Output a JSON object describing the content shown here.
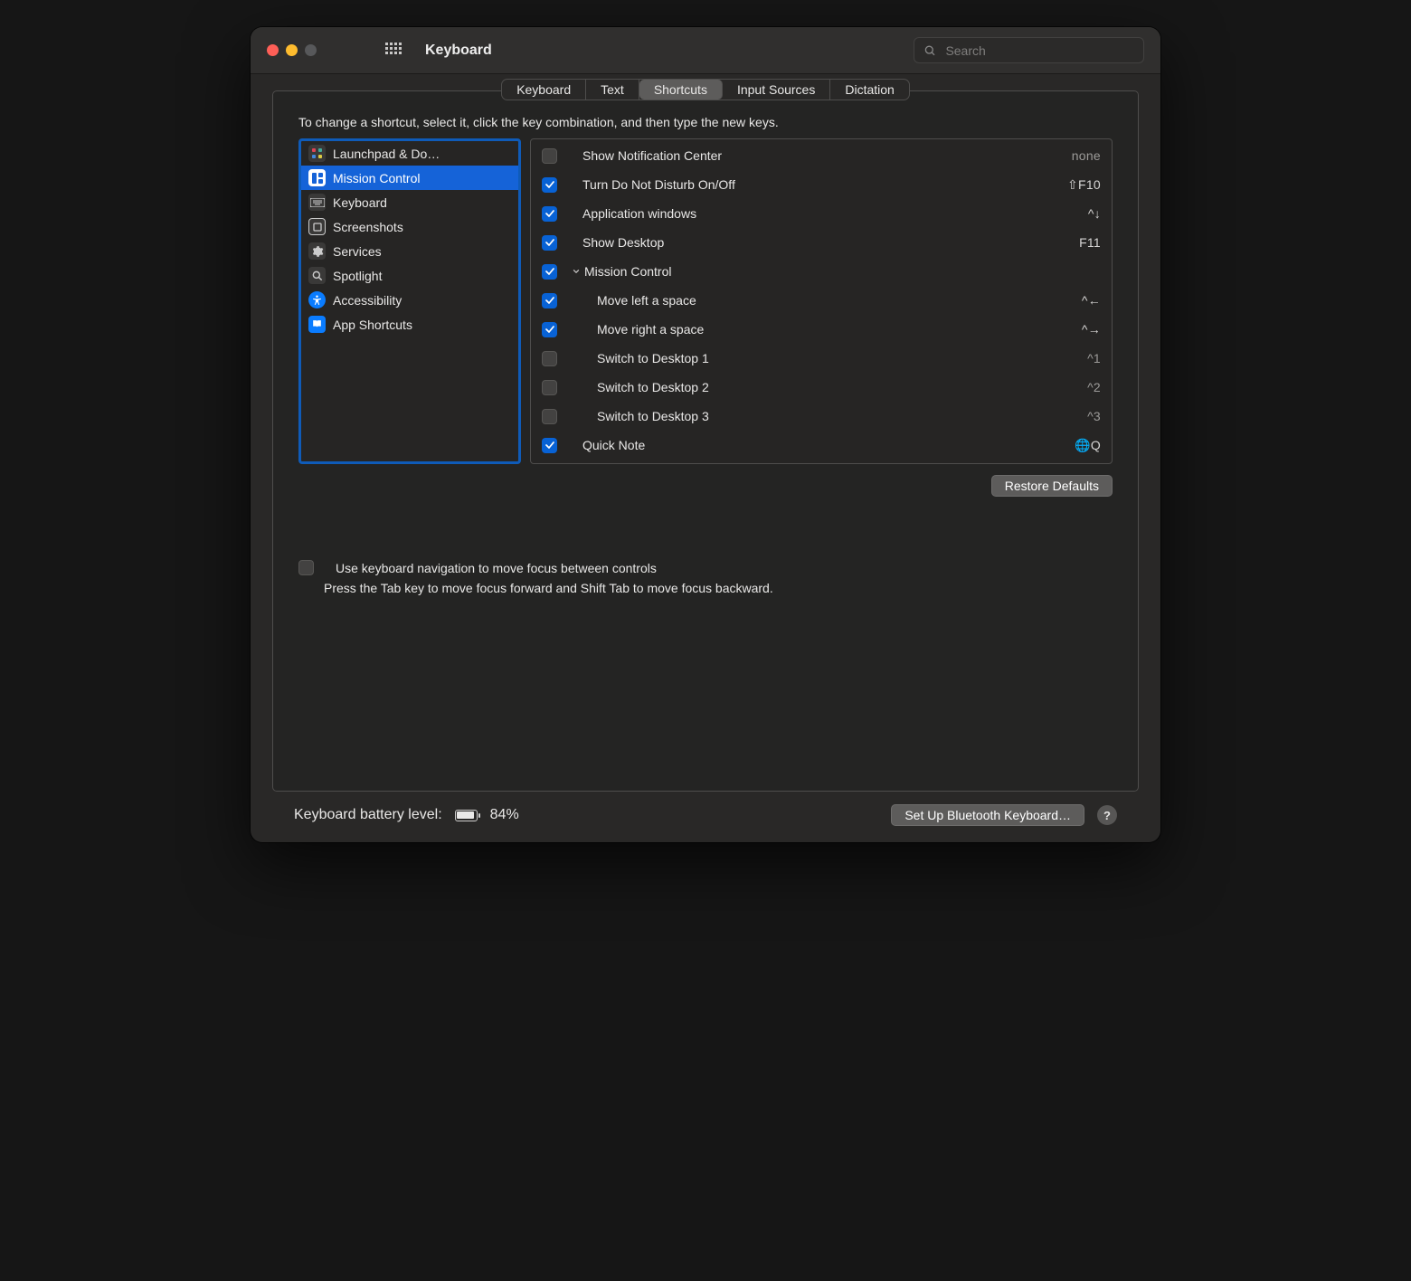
{
  "window": {
    "title": "Keyboard"
  },
  "search": {
    "placeholder": "Search"
  },
  "tabs": [
    "Keyboard",
    "Text",
    "Shortcuts",
    "Input Sources",
    "Dictation"
  ],
  "active_tab": 2,
  "instructions": "To change a shortcut, select it, click the key combination, and then type the new keys.",
  "sidebar": {
    "items": [
      {
        "label": "Launchpad & Do…",
        "icon": "launchpad",
        "selected": false
      },
      {
        "label": "Mission Control",
        "icon": "mission-control",
        "selected": true
      },
      {
        "label": "Keyboard",
        "icon": "keyboard",
        "selected": false
      },
      {
        "label": "Screenshots",
        "icon": "screenshots",
        "selected": false
      },
      {
        "label": "Services",
        "icon": "services",
        "selected": false
      },
      {
        "label": "Spotlight",
        "icon": "spotlight",
        "selected": false
      },
      {
        "label": "Accessibility",
        "icon": "accessibility",
        "selected": false
      },
      {
        "label": "App Shortcuts",
        "icon": "app-shortcuts",
        "selected": false
      }
    ]
  },
  "shortcuts": [
    {
      "checked": false,
      "label": "Show Notification Center",
      "key": "none",
      "dim": true,
      "group": false,
      "indent": 0
    },
    {
      "checked": true,
      "label": "Turn Do Not Disturb On/Off",
      "key": "⇧F10",
      "dim": false,
      "group": false,
      "indent": 0
    },
    {
      "checked": true,
      "label": "Application windows",
      "key": "^↓",
      "dim": false,
      "group": false,
      "indent": 0
    },
    {
      "checked": true,
      "label": "Show Desktop",
      "key": "F11",
      "dim": false,
      "group": false,
      "indent": 0
    },
    {
      "checked": true,
      "label": "Mission Control",
      "key": "",
      "dim": false,
      "group": true,
      "indent": 0
    },
    {
      "checked": true,
      "label": "Move left a space",
      "key": "^←",
      "dim": false,
      "group": false,
      "indent": 1
    },
    {
      "checked": true,
      "label": "Move right a space",
      "key": "^→",
      "dim": false,
      "group": false,
      "indent": 1
    },
    {
      "checked": false,
      "label": "Switch to Desktop 1",
      "key": "^1",
      "dim": true,
      "group": false,
      "indent": 1
    },
    {
      "checked": false,
      "label": "Switch to Desktop 2",
      "key": "^2",
      "dim": true,
      "group": false,
      "indent": 1
    },
    {
      "checked": false,
      "label": "Switch to Desktop 3",
      "key": "^3",
      "dim": true,
      "group": false,
      "indent": 1
    },
    {
      "checked": true,
      "label": "Quick Note",
      "key": "🌐Q",
      "dim": false,
      "group": false,
      "indent": 0
    }
  ],
  "buttons": {
    "restore_defaults": "Restore Defaults",
    "setup_bluetooth": "Set Up Bluetooth Keyboard…"
  },
  "keyboard_nav": {
    "checkbox_label": "Use keyboard navigation to move focus between controls",
    "description": "Press the Tab key to move focus forward and Shift Tab to move focus backward."
  },
  "footer": {
    "battery_label": "Keyboard battery level:",
    "battery_percent": "84%"
  }
}
